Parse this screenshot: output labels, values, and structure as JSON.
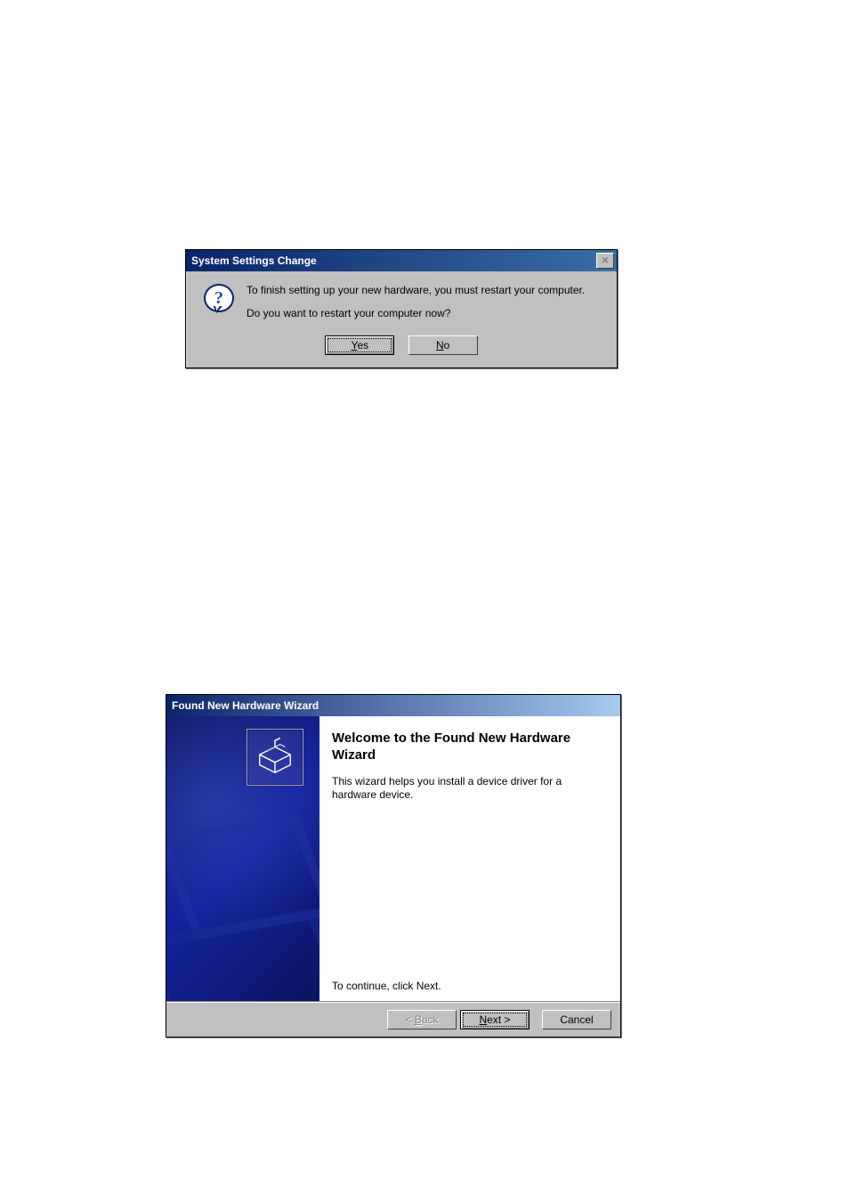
{
  "dialog1": {
    "title": "System Settings Change",
    "close_label": "✕",
    "message_line1": "To finish setting up your new hardware, you must restart your computer.",
    "message_line2": "Do you want to restart your computer now?",
    "yes_underline": "Y",
    "yes_rest": "es",
    "no_underline": "N",
    "no_rest": "o"
  },
  "dialog2": {
    "title": "Found New Hardware Wizard",
    "welcome_title": "Welcome to the Found New Hardware Wizard",
    "description": "This wizard helps you install a device driver for a hardware device.",
    "continue_hint": "To continue, click Next.",
    "back_prefix": "< ",
    "back_underline": "B",
    "back_rest": "ack",
    "next_underline": "N",
    "next_rest": "ext >",
    "cancel_label": "Cancel"
  }
}
